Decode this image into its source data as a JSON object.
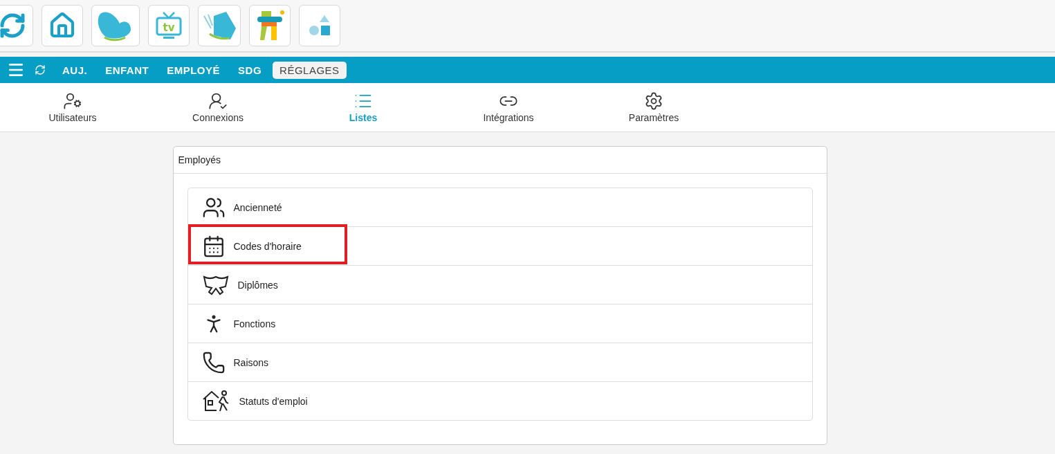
{
  "app_tiles": [
    {
      "kind": "refresh"
    },
    {
      "kind": "home"
    },
    {
      "kind": "leaf"
    },
    {
      "kind": "tv",
      "label": "tv"
    },
    {
      "kind": "leaf2"
    },
    {
      "kind": "inukshuk"
    },
    {
      "kind": "shapes"
    }
  ],
  "nav": {
    "items": [
      {
        "label": "AUJ.",
        "selected": false
      },
      {
        "label": "ENFANT",
        "selected": false
      },
      {
        "label": "EMPLOYÉ",
        "selected": false
      },
      {
        "label": "SDG",
        "selected": false
      },
      {
        "label": "RÉGLAGES",
        "selected": true
      }
    ]
  },
  "subtabs": [
    {
      "kind": "users",
      "label": "Utilisateurs",
      "selected": false
    },
    {
      "kind": "connections",
      "label": "Connexions",
      "selected": false
    },
    {
      "kind": "lists",
      "label": "Listes",
      "selected": true
    },
    {
      "kind": "integrations",
      "label": "Intégrations",
      "selected": false
    },
    {
      "kind": "settings",
      "label": "Paramètres",
      "selected": false
    }
  ],
  "card": {
    "title": "Employés",
    "items": [
      {
        "kind": "group",
        "label": "Ancienneté",
        "highlighted": false
      },
      {
        "kind": "calendar",
        "label": "Codes d'horaire",
        "highlighted": true
      },
      {
        "kind": "bow",
        "label": "Diplômes",
        "highlighted": false
      },
      {
        "kind": "person",
        "label": "Fonctions",
        "highlighted": false
      },
      {
        "kind": "phone",
        "label": "Raisons",
        "highlighted": false
      },
      {
        "kind": "leave",
        "label": "Statuts d'emploi",
        "highlighted": false
      }
    ]
  }
}
